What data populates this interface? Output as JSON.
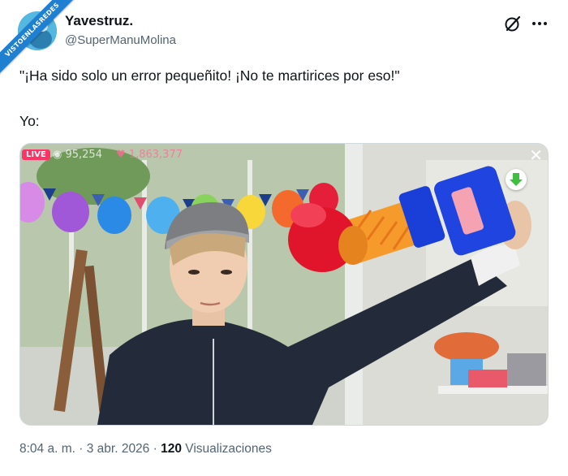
{
  "watermark": {
    "text": "VISTOENLASREDES"
  },
  "tweet": {
    "author": {
      "display_name": "Yavestruz.",
      "handle": "@SuperManuMolina"
    },
    "text": {
      "line1": "\"¡Ha sido solo un error pequeñito! ¡No te martirices por eso!\"",
      "line2": "Yo:"
    },
    "media": {
      "live_label": "LIVE",
      "viewers": "95,254",
      "hearts": "1,863,377",
      "close_glyph": "✕"
    },
    "footer": {
      "time": "8:04 a. m.",
      "separator1": "·",
      "date": "3 abr. 2026",
      "separator2": "·",
      "views_count": "120",
      "views_label": "Visualizaciones"
    }
  },
  "icons": {
    "grok": "grok-icon",
    "more": "more-icon",
    "download": "download-icon",
    "close": "close-icon"
  },
  "colors": {
    "text_primary": "#0f1419",
    "text_secondary": "#536471",
    "ribbon": "#1f7fd1",
    "live_badge": "#ff3366"
  }
}
